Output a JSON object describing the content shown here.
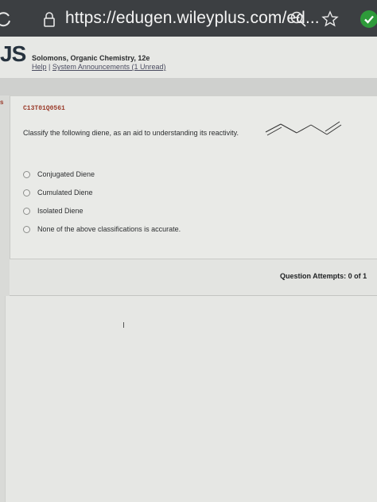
{
  "browser": {
    "url": "https://edugen.wileyplus.com/ed..."
  },
  "header": {
    "logo": "JS",
    "course_title": "Solomons, Organic Chemistry, 12e",
    "links": {
      "help": "Help",
      "separator": "|",
      "announcements": "System Announcements (1 Unread)"
    },
    "left_marker": "s"
  },
  "question": {
    "id": "C13T01Q0561",
    "prompt": "Classify the following diene, as an aid to understanding its reactivity.",
    "options": [
      {
        "label": "Conjugated Diene"
      },
      {
        "label": "Cumulated Diene"
      },
      {
        "label": "Isolated Diene"
      },
      {
        "label": "None of the above classifications is accurate."
      }
    ]
  },
  "attempts": {
    "text": "Question Attempts: 0 of 1"
  },
  "colors": {
    "browser_bar": "#3c3f42",
    "question_id": "#9a3b2a",
    "page_background": "#e9eae7"
  }
}
